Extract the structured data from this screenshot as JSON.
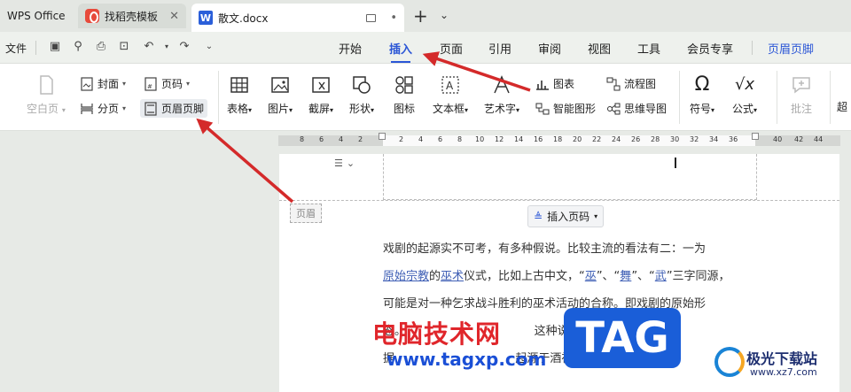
{
  "tabs": [
    {
      "label": "WPS Office"
    },
    {
      "label": "找稻壳模板"
    },
    {
      "label": "散文.docx"
    }
  ],
  "menubar": {
    "file": "文件",
    "items": [
      "开始",
      "插入",
      "页面",
      "引用",
      "审阅",
      "视图",
      "工具",
      "会员专享",
      "页眉页脚"
    ],
    "active": "插入"
  },
  "ribbon": {
    "blank_page": "空白页",
    "cover": "封面",
    "page_num": "页码",
    "section_break": "分页",
    "header_footer": "页眉页脚",
    "table": "表格",
    "picture": "图片",
    "screenshot": "截屏",
    "shape": "形状",
    "icon": "图标",
    "textbox": "文本框",
    "art_text": "艺术字",
    "chart": "图表",
    "smart_graphic": "智能图形",
    "flowchart": "流程图",
    "mindmap": "思维导图",
    "symbol": "符号",
    "formula": "公式",
    "comment": "批注",
    "more": "超"
  },
  "ruler": {
    "ticks": [
      "8",
      "6",
      "4",
      "2",
      "2",
      "4",
      "6",
      "8",
      "10",
      "12",
      "14",
      "16",
      "18",
      "20",
      "22",
      "24",
      "26",
      "28",
      "30",
      "32",
      "34",
      "36",
      "40",
      "42",
      "44"
    ]
  },
  "document": {
    "header_label": "页眉",
    "insert_page_num": "插入页码",
    "lines": [
      {
        "segments": [
          {
            "t": "戏剧的起源实不可考，有多种假说。比较主流的看法有二：一为"
          }
        ]
      },
      {
        "segments": [
          {
            "t": "原始宗教",
            "u": true
          },
          {
            "t": "的"
          },
          {
            "t": "巫术",
            "u": true
          },
          {
            "t": "仪式，比如上古中文，“"
          },
          {
            "t": "巫",
            "u": true
          },
          {
            "t": "”、“"
          },
          {
            "t": "舞",
            "u": true
          },
          {
            "t": "”、“"
          },
          {
            "t": "武",
            "u": true
          },
          {
            "t": "”三字同源，"
          }
        ]
      },
      {
        "segments": [
          {
            "t": "可能是对一种乞求战斗胜利的巫术活动的合称。即戏剧的原始形"
          }
        ]
      },
      {
        "segments": [
          {
            "t": "态。"
          },
          {
            "t": "                                   "
          },
          {
            "t": "这种说法主要依"
          }
        ]
      },
      {
        "segments": [
          {
            "t": "据"
          },
          {
            "t": "                                 "
          },
          {
            "t": "起源于酒神祭祀"
          }
        ]
      }
    ]
  },
  "watermarks": {
    "site_cn": "电脑技术网",
    "site_url": "www.tagxp.com",
    "tag": "TAG",
    "brand": "极光下载站",
    "brand_url": "www.xz7.com"
  },
  "colors": {
    "accent": "#2b56d6",
    "arrow": "#d42a2a"
  }
}
